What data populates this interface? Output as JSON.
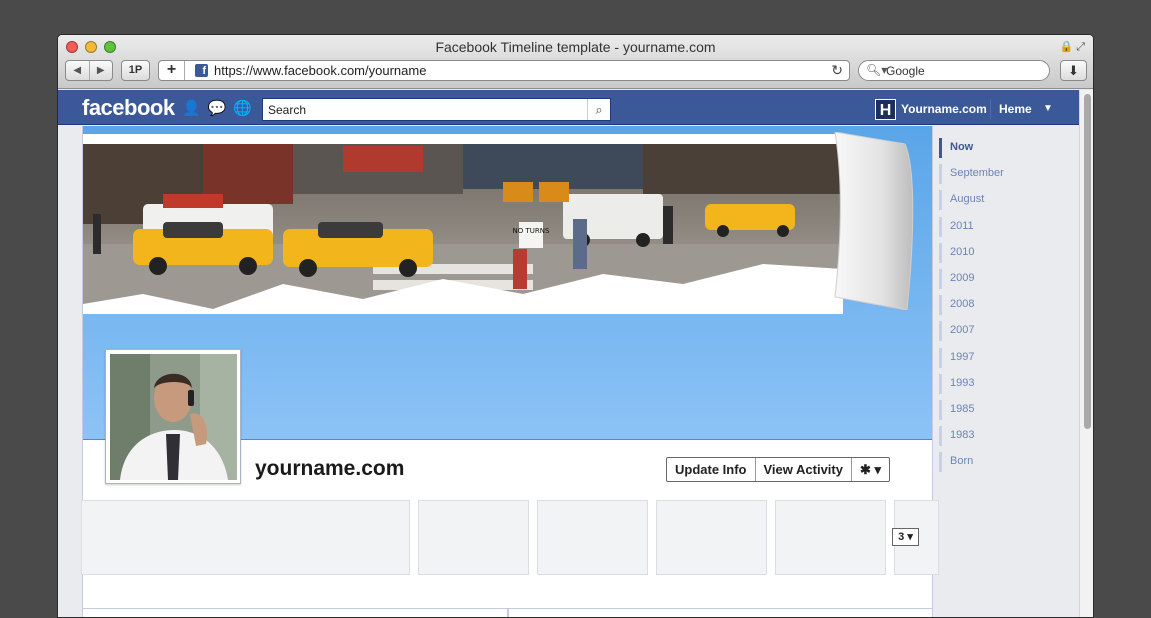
{
  "browser": {
    "window_title": "Facebook Timeline template - yourname.com",
    "address_url": "https://www.facebook.com/yourname",
    "search_placeholder": "Google",
    "onep_label": "1P",
    "plus_label": "+"
  },
  "fb": {
    "logo": "facebook",
    "search_placeholder": "Search",
    "avatar_letter": "H",
    "user_name": "Yourname.com",
    "home_label": "Heme",
    "profile_name": "yourname.com",
    "actions": {
      "update_info": "Update Info",
      "view_activity": "View Activity",
      "gear_symbol": "✱ ▾"
    },
    "pager_label": "3 ▾",
    "cover_sign_text": "NO TURNS",
    "years": [
      "Now",
      "September",
      "August",
      "2011",
      "2010",
      "2009",
      "2008",
      "2007",
      "1997",
      "1993",
      "1985",
      "1983",
      "Born"
    ]
  },
  "colors": {
    "fb_blue": "#3b5998",
    "cover_sky": "#6eb2ee",
    "timeline_year": "#6d84b4",
    "taxi": "#f2b51c"
  },
  "icons": {
    "friends": "friends-icon",
    "messages": "messages-icon",
    "notifications": "globe-icon",
    "search": "magnifier-icon"
  }
}
